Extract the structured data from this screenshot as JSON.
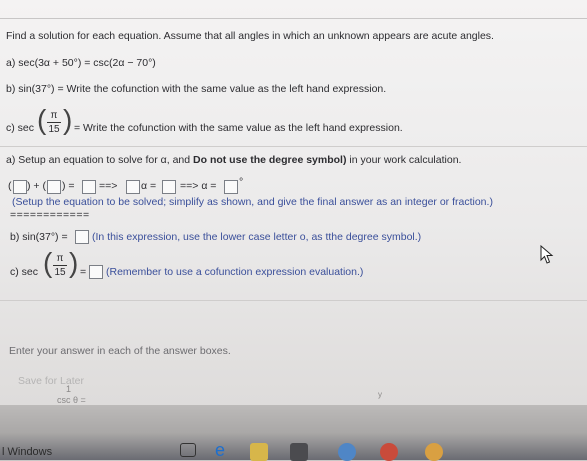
{
  "question": {
    "instruction": "Find a solution for each equation. Assume that all angles in which an unknown appears are acute angles.",
    "part_a": "a) sec(3α + 50°) = csc(2α − 70°)",
    "part_b": "b) sin(37°) = Write the cofunction with the same value as the left hand expression.",
    "part_c_prefix": "c) sec",
    "part_c_suffix": "= Write the cofunction with the same value as the left hand expression.",
    "frac_num": "π",
    "frac_den": "15"
  },
  "answers": {
    "a_heading_pre": "a) Setup an equation to solve for α, and ",
    "a_heading_bold": "Do not use the degree symbol)",
    "a_heading_post": " in your work calculation.",
    "plus": "+",
    "equals": "=",
    "arrow": "==>",
    "alpha_eq": "α =",
    "arrow2": "==> α =",
    "degree": "°",
    "a_hint": "(Setup the equation to be solved; simplify as shown, and give the final answer as an integer or fraction.)",
    "divider": "============",
    "b_prefix": "b) sin(37°) =",
    "b_hint": "(In this expression, use the lower case letter o, as tthe degree symbol.)",
    "c_prefix": "c) sec",
    "c_equals": "=",
    "c_hint": "(Remember to use a cofunction expression evaluation.)"
  },
  "footer": {
    "enter_prompt": "Enter your answer in each of the answer boxes.",
    "save_label": "Save for Later",
    "bottom_formula": "csc θ =",
    "bottom_one": "1",
    "bottom_y": "y"
  },
  "taskbar": {
    "windows_label": "l Windows"
  },
  "colors": {
    "hint_blue": "#3a4f9a",
    "box_border": "#7b7f86"
  }
}
